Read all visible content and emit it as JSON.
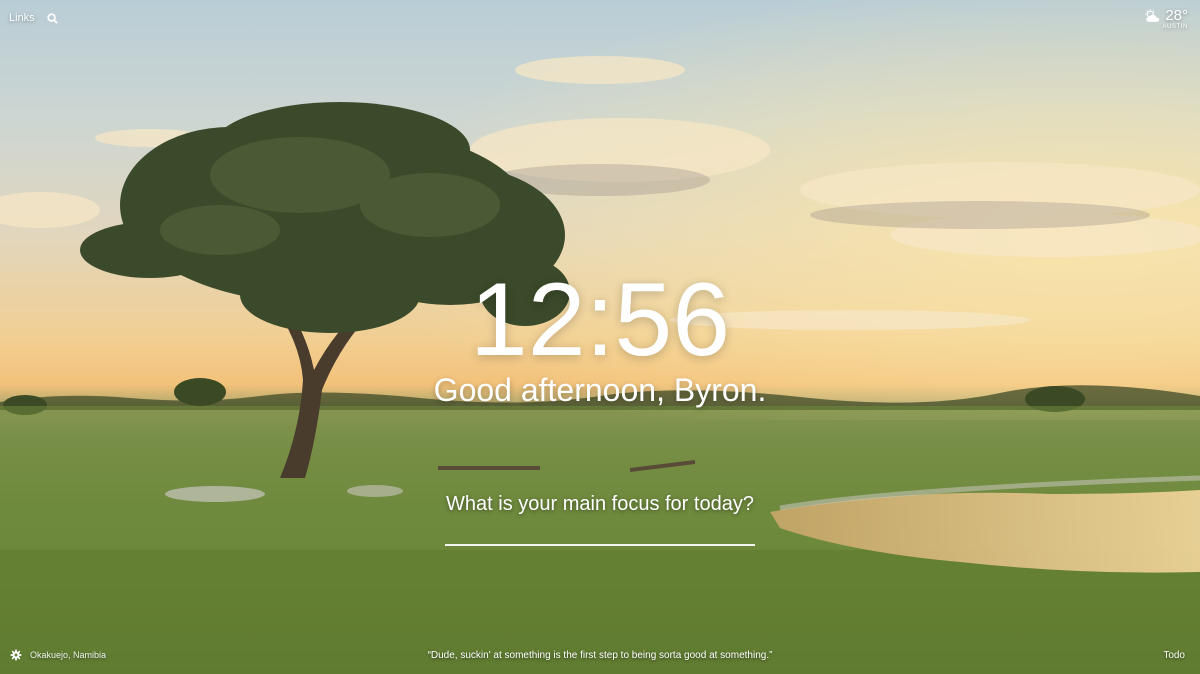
{
  "top_left": {
    "links_label": "Links",
    "search_icon": "search-icon"
  },
  "weather": {
    "icon": "partly-cloudy-icon",
    "temperature": "28°",
    "location": "AUSTIN"
  },
  "center": {
    "time": "12:56",
    "greeting": "Good afternoon, Byron.",
    "focus_question": "What is your main focus for today?",
    "focus_value": ""
  },
  "bottom": {
    "settings_icon": "gear-icon",
    "photo_location": "Okakuejo, Namibia",
    "quote": "“Dude, suckin' at something is the first step to being sorta good at something.”",
    "todo_label": "Todo"
  },
  "colors": {
    "sky_top": "#b9cdd6",
    "horizon": "#f3c27a",
    "grass": "#6d8a3e",
    "text": "#ffffff"
  }
}
